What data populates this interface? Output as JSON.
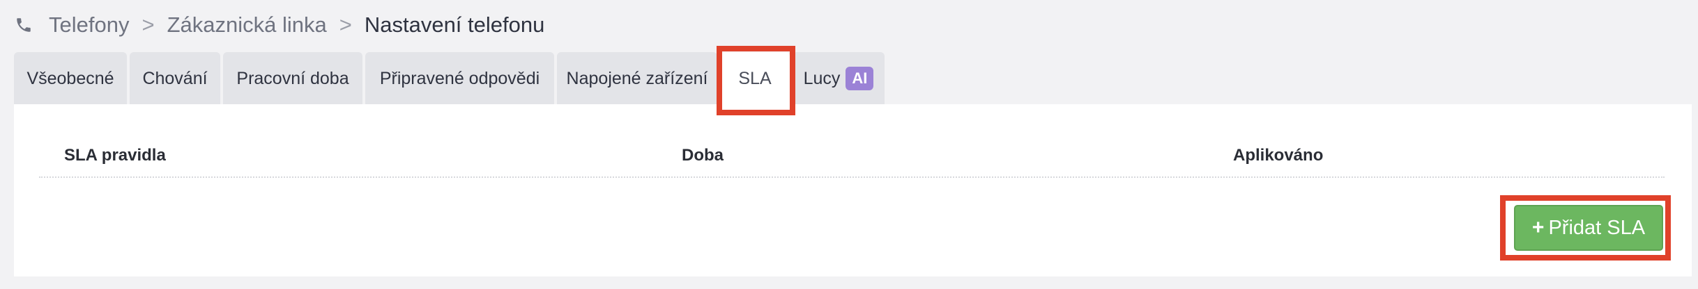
{
  "breadcrumb": {
    "icon": "phone-icon",
    "items": [
      "Telefony",
      "Zákaznická linka",
      "Nastavení telefonu"
    ],
    "separator": ">"
  },
  "tabs": [
    {
      "label": "Všeobecné"
    },
    {
      "label": "Chování"
    },
    {
      "label": "Pracovní doba"
    },
    {
      "label": "Připravené odpovědi"
    },
    {
      "label": "Napojené zařízení"
    },
    {
      "label": "SLA",
      "active": true
    },
    {
      "label": "Lucy",
      "badge": "AI"
    }
  ],
  "table": {
    "columns": [
      "SLA pravidla",
      "Doba",
      "Aplikováno"
    ]
  },
  "actions": {
    "add_sla_label": "Přidat SLA",
    "add_icon": "plus-icon",
    "add_icon_glyph": "+"
  },
  "colors": {
    "highlight": "#e0412a",
    "button": "#6cb760",
    "ai_badge": "#9b82d6"
  }
}
